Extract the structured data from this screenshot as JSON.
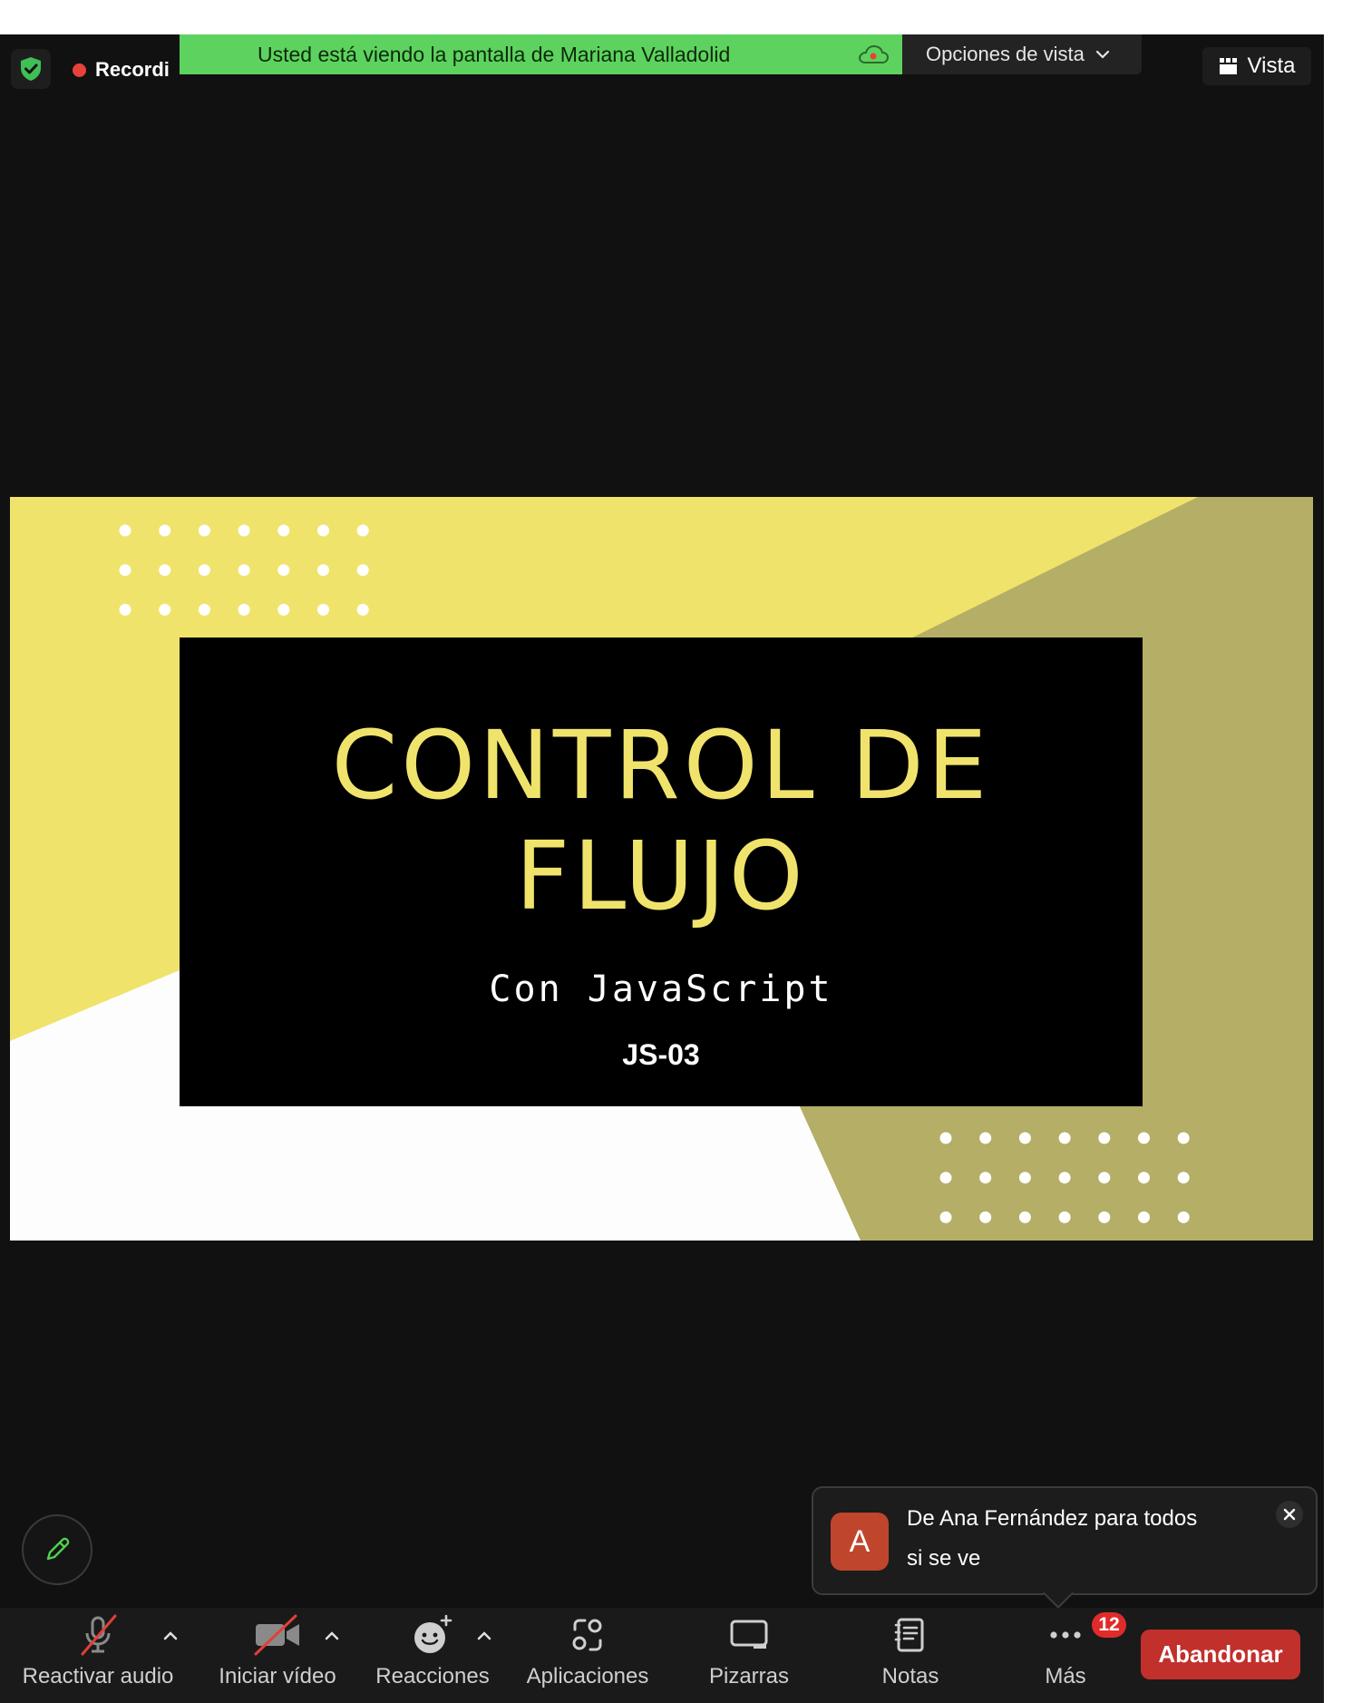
{
  "top_bar": {
    "recording_label": "Recordi",
    "banner_text": "Usted está viendo la pantalla de Mariana Valladolid",
    "view_options_label": "Opciones de vista",
    "view_label": "Vista"
  },
  "slide": {
    "title_line1": "CONTROL DE",
    "title_line2": "FLUJO",
    "subtitle": "Con JavaScript",
    "code": "JS-03"
  },
  "chat_notification": {
    "avatar_letter": "A",
    "from": "De Ana Fernández para todos",
    "message": "si se ve"
  },
  "toolbar": {
    "unmute_label": "Reactivar audio",
    "start_video_label": "Iniciar vídeo",
    "reactions_label": "Reacciones",
    "apps_label": "Aplicaciones",
    "whiteboards_label": "Pizarras",
    "notes_label": "Notas",
    "more_label": "Más",
    "more_badge": "12",
    "leave_label": "Abandonar"
  },
  "colors": {
    "banner_green": "#5ed25e",
    "slide_yellow": "#f0e36c",
    "slide_olive": "#b4ae66",
    "leave_red": "#c2302c",
    "badge_red": "#e02b2b",
    "avatar": "#c0452d"
  }
}
